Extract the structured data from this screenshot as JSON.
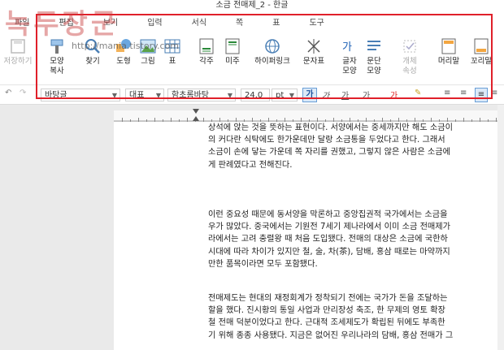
{
  "window": {
    "title": "소금 전매제_2 - 한글"
  },
  "menu": {
    "items": [
      "파일",
      "편집",
      "보기",
      "입력",
      "서식",
      "쪽",
      "표",
      "도구"
    ]
  },
  "watermark": {
    "text": "녹두장군",
    "url": "http://mania.tistory.com"
  },
  "ribbon": {
    "buttons": [
      {
        "label": "저장하기",
        "icon": "save-icon",
        "enabled": false
      },
      {
        "label": "모양\n복사",
        "icon": "format-painter-icon",
        "enabled": true
      },
      {
        "label": "찾기",
        "icon": "find-icon",
        "enabled": true
      },
      {
        "label": "도형",
        "icon": "shape-icon",
        "enabled": true
      },
      {
        "label": "그림",
        "icon": "picture-icon",
        "enabled": true
      },
      {
        "label": "표",
        "icon": "table-icon",
        "enabled": true
      },
      {
        "label": "각주",
        "icon": "footnote-icon",
        "enabled": true
      },
      {
        "label": "미주",
        "icon": "endnote-icon",
        "enabled": true
      },
      {
        "label": "하이퍼링크",
        "icon": "hyperlink-icon",
        "enabled": true
      },
      {
        "label": "문자표",
        "icon": "symbol-icon",
        "enabled": true
      },
      {
        "label": "글자\n모양",
        "icon": "char-shape-icon",
        "enabled": true
      },
      {
        "label": "문단\n모양",
        "icon": "para-shape-icon",
        "enabled": true
      },
      {
        "label": "개체\n속성",
        "icon": "object-props-icon",
        "enabled": false
      },
      {
        "label": "머리말",
        "icon": "header-icon",
        "enabled": true
      },
      {
        "label": "꼬리말",
        "icon": "footer-icon",
        "enabled": true
      }
    ]
  },
  "format": {
    "style": "바탕글",
    "lang": "대표",
    "font": "함초롬바탕",
    "size": "24.0",
    "unit": "pt"
  },
  "document": {
    "paragraphs": [
      [
        "상석에 앉는 것을 뜻하는 표현이다. 서양에서는 중세까지만 해도 소금이",
        "의 커다란 식탁에도 한가운데만 달랑 소금통을 두었다고 한다. 그래서",
        "소금이 손에 닿는 가운데 쪽 자리를 권했고, 그렇지 않은 사람은 소금에",
        "게 판례였다고 전해진다."
      ],
      [
        "이런 중요성 때문에 동서양을 막론하고 중앙집권적 국가에서는 소금을",
        "우가 많았다. 중국에서는 기원전 7세기 제나라에서 이미 소금 전매제가",
        "라에서는 고려 충렬왕 때 처음 도입됐다. 전매의 대상은 소금에 국한하",
        "시대에 따라 차이가 있지만 철, 술, 차(茶), 담배, 홍삼 때로는 마약까지",
        "만한 품목이라면 모두 포함됐다."
      ],
      [
        "전매제도는 현대의 재정회계가 정착되기 전에는 국가가 돈을 조달하는",
        "할을 했다. 진시황의 통일 사업과 만리장성 축조, 한 무제의 영토 확장",
        "철 전매 덕분이었다고 한다. 근대적 조세제도가 확립된 뒤에도 부족한",
        "기 위해 종종 사용됐다. 지금은 없어진 우리나라의 담배, 홍삼 전매가 그"
      ]
    ]
  },
  "colors": {
    "highlight_box": "#e0202a",
    "watermark": "#c83c3c"
  }
}
